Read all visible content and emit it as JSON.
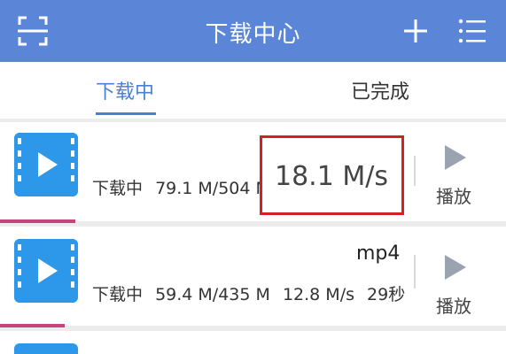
{
  "header": {
    "title": "下载中心"
  },
  "tabs": [
    {
      "label": "下载中",
      "active": true
    },
    {
      "label": "已完成",
      "active": false
    }
  ],
  "downloads": [
    {
      "name": "",
      "status": "下载中",
      "progress_text": "79.1 M/504 M",
      "play_label": "播放",
      "progress_fraction": 0.157
    },
    {
      "name": "mp4",
      "status": "下载中",
      "progress_text": "59.4 M/435 M",
      "speed": "12.8 M/s",
      "remaining": "29秒",
      "play_label": "播放",
      "progress_fraction": 0.137
    }
  ],
  "highlight": {
    "speed": "18.1 M/s"
  },
  "colors": {
    "header_bg": "#5b86d8",
    "tab_active": "#4a7fd6",
    "thumb_bg": "#2d98ea",
    "progress": "#c4457a",
    "highlight_border": "#d32121"
  },
  "icons": {
    "scan": "scan-icon",
    "add": "plus-icon",
    "menu": "menu-icon",
    "video": "video-file-icon",
    "play": "play-icon"
  }
}
